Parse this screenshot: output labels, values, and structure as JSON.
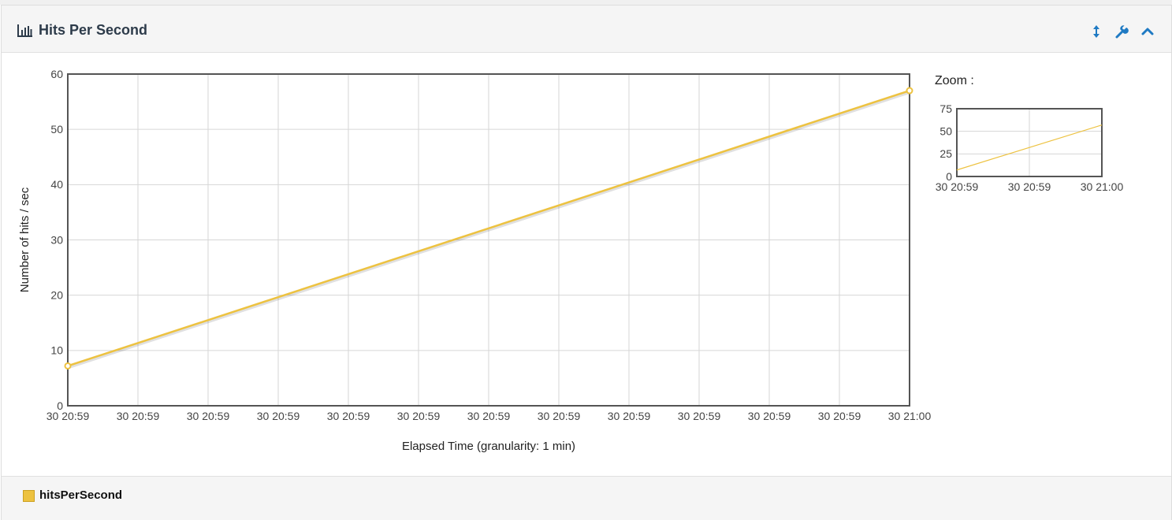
{
  "panel": {
    "title": "Hits Per Second",
    "title_icon": "bar-chart-icon",
    "tools": [
      {
        "name": "resize-vertical-icon"
      },
      {
        "name": "wrench-icon"
      },
      {
        "name": "chevron-up-icon"
      }
    ]
  },
  "zoom": {
    "label": "Zoom :"
  },
  "legend": {
    "items": [
      {
        "label": "hitsPerSecond",
        "color": "#edc240"
      }
    ]
  },
  "colors": {
    "series": "#edc240",
    "grid": "#d6d6d6",
    "frame": "#545454",
    "accent": "#1f7ac3"
  },
  "chart_data": [
    {
      "type": "line",
      "xlabel": "Elapsed Time (granularity: 1 min)",
      "ylabel": "Number of hits / sec",
      "ylim": [
        0,
        60
      ],
      "yticks": [
        0,
        10,
        20,
        30,
        40,
        50,
        60
      ],
      "xtick_labels": [
        "30 20:59",
        "30 20:59",
        "30 20:59",
        "30 20:59",
        "30 20:59",
        "30 20:59",
        "30 20:59",
        "30 20:59",
        "30 20:59",
        "30 20:59",
        "30 20:59",
        "30 20:59",
        "30 21:00"
      ],
      "grid": true,
      "series": [
        {
          "name": "hitsPerSecond",
          "x_index": [
            0,
            12
          ],
          "values": [
            7.2,
            57
          ]
        }
      ]
    },
    {
      "type": "line",
      "ylim": [
        0,
        75
      ],
      "yticks": [
        0,
        25,
        50,
        75
      ],
      "xtick_labels": [
        "30 20:59",
        "30 20:59",
        "30 21:00"
      ],
      "grid": true,
      "series": [
        {
          "name": "hitsPerSecond",
          "x_index": [
            0,
            2
          ],
          "values": [
            7.2,
            57
          ]
        }
      ]
    }
  ]
}
